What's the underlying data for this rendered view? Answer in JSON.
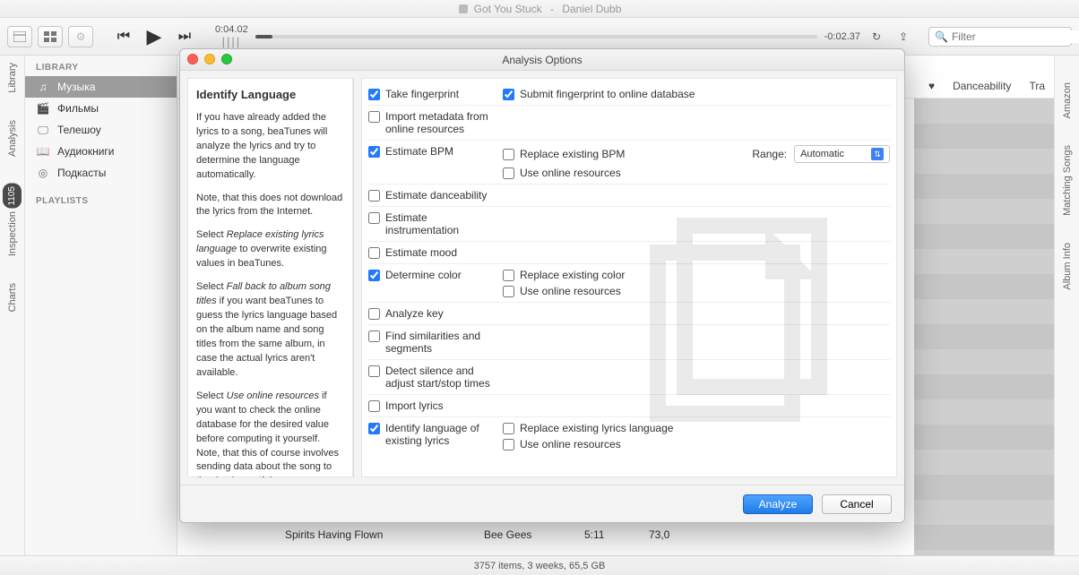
{
  "title_bar": {
    "now_playing_title": "Got You Stuck",
    "now_playing_artist": "Daniel Dubb"
  },
  "toolbar": {
    "time_elapsed": "0:04.02",
    "time_remain": "-0:02.37",
    "search_placeholder": "Filter"
  },
  "left_tabs": {
    "library": "Library",
    "analysis": "Analysis",
    "inspection": "Inspection",
    "inspection_badge": "1105",
    "charts": "Charts"
  },
  "right_tabs": {
    "amazon": "Amazon",
    "matching": "Matching Songs",
    "album": "Album Info"
  },
  "sidebar": {
    "library_header": "LIBRARY",
    "playlists_header": "PLAYLISTS",
    "items": [
      {
        "label": "Музыка"
      },
      {
        "label": "Фильмы"
      },
      {
        "label": "Телешоу"
      },
      {
        "label": "Аудиокниги"
      },
      {
        "label": "Подкасты"
      }
    ]
  },
  "columns": {
    "heart": "♥",
    "danceability": "Danceability",
    "track": "Tra"
  },
  "visible_row": {
    "name": "Spirits Having Flown",
    "artist": "Bee Gees",
    "time": "5:11",
    "bpm": "73,0"
  },
  "status": "3757 items, 3 weeks, 65,5 GB",
  "dialog": {
    "title": "Analysis Options",
    "help": {
      "heading": "Identify Language",
      "p1": "If you have already added the lyrics to a song, beaTunes will analyze the lyrics and try to determine the language automatically.",
      "p2": "Note, that this does not download the lyrics from the Internet.",
      "p3_a": "Select ",
      "p3_em": "Replace existing lyrics language",
      "p3_b": " to overwrite existing values in beaTunes.",
      "p4_a": "Select ",
      "p4_em": "Fall back to album song titles",
      "p4_b": " if you want beaTunes to guess the lyrics language based on the album name and song titles from the same album, in case the actual lyrics aren't available.",
      "p5_a": "Select ",
      "p5_em": "Use online resources",
      "p5_b": " if you want to check the online database for the desired value before computing it yourself. Note, that this of course involves sending data about the song to the database. If the"
    },
    "options": {
      "take_fingerprint": "Take fingerprint",
      "submit_fingerprint": "Submit fingerprint to online database",
      "import_metadata": "Import metadata from online resources",
      "estimate_bpm": "Estimate BPM",
      "replace_bpm": "Replace existing BPM",
      "use_online_bpm": "Use online resources",
      "range_label": "Range:",
      "range_value": "Automatic",
      "estimate_dance": "Estimate danceability",
      "estimate_instr": "Estimate instrumentation",
      "estimate_mood": "Estimate mood",
      "determine_color": "Determine color",
      "replace_color": "Replace existing color",
      "use_online_color": "Use online resources",
      "analyze_key": "Analyze key",
      "find_similar": "Find similarities and segments",
      "detect_silence": "Detect silence and adjust start/stop times",
      "import_lyrics": "Import lyrics",
      "identify_language": "Identify language of existing lyrics",
      "replace_language": "Replace existing lyrics language",
      "use_online_lang": "Use online resources"
    },
    "buttons": {
      "analyze": "Analyze",
      "cancel": "Cancel"
    }
  }
}
